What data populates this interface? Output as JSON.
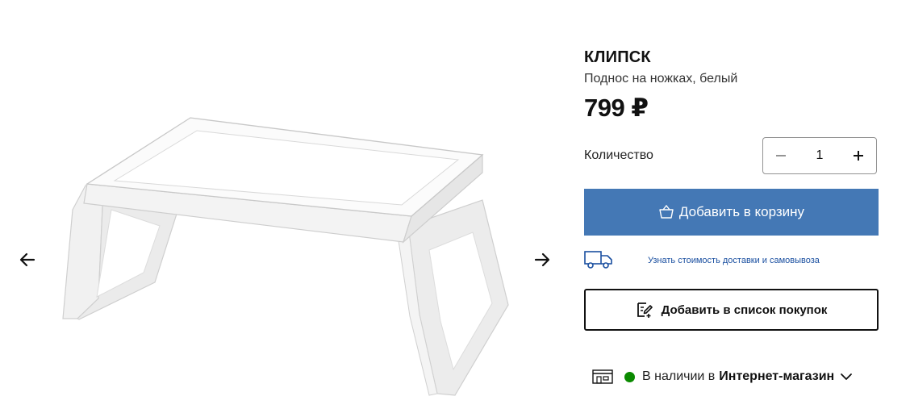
{
  "product": {
    "name": "КЛИПСК",
    "description": "Поднос на ножках, белый",
    "price": "799 ₽"
  },
  "quantity": {
    "label": "Количество",
    "value": "1",
    "decrement_icon": "minus-icon",
    "increment_icon": "plus-icon"
  },
  "cart": {
    "label": "Добавить в корзину",
    "icon": "basket-icon",
    "color": "#4478b5"
  },
  "delivery": {
    "link": "Узнать стоимость доставки и самовывоза",
    "icon": "delivery-truck-icon"
  },
  "shopping_list": {
    "label": "Добавить в список покупок",
    "icon": "list-edit-icon"
  },
  "availability": {
    "text": "В наличии в",
    "store": "Интернет-магазин",
    "status_color": "#0a8a00",
    "icon": "store-icon"
  },
  "gallery": {
    "prev_icon": "arrow-left-icon",
    "next_icon": "arrow-right-icon",
    "image": "bed-tray-image"
  }
}
